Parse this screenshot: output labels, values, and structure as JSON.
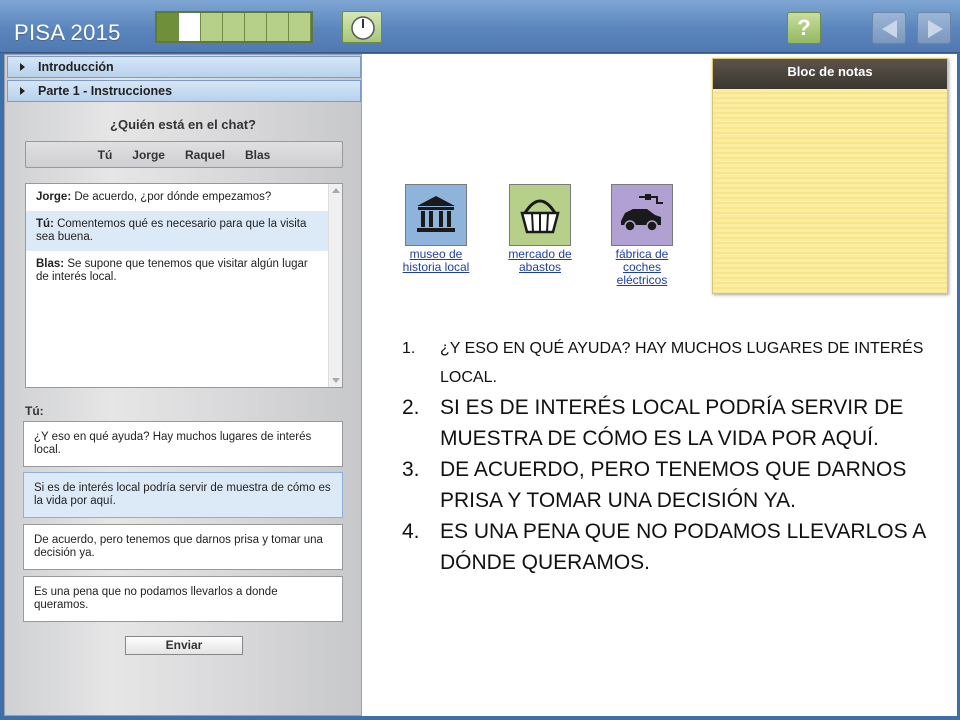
{
  "header": {
    "title": "PISA 2015",
    "progress": {
      "total_cells": 7,
      "completed": 1,
      "current": 2
    },
    "help_label": "?"
  },
  "left_pane": {
    "tabs": [
      {
        "label": "Introducción"
      },
      {
        "label": "Parte 1 - Instrucciones"
      }
    ],
    "chat_question": "¿Quién está en el chat?",
    "participants": [
      "Tú",
      "Jorge",
      "Raquel",
      "Blas"
    ],
    "messages": [
      {
        "speaker": "Jorge:",
        "text": "De acuerdo, ¿por dónde empezamos?"
      },
      {
        "speaker": "Tú:",
        "text": "Comentemos qué es necesario para que la visita sea buena."
      },
      {
        "speaker": "Blas:",
        "text": "Se supone que tenemos que visitar algún lugar de interés local."
      }
    ],
    "you_label": "Tú:",
    "options": [
      "¿Y eso en qué ayuda? Hay muchos lugares de interés local.",
      "Si es de interés local podría servir de muestra de cómo es la vida por aquí.",
      "De acuerdo, pero tenemos que darnos prisa y tomar una decisión ya.",
      "Es una pena que no podamos llevarlos a donde queramos."
    ],
    "send_label": "Enviar"
  },
  "right_pane": {
    "notepad_title": "Bloc de notas",
    "places": [
      {
        "label": "museo de historia local",
        "icon": "museum-icon"
      },
      {
        "label": "mercado de abastos",
        "icon": "basket-icon"
      },
      {
        "label": "fábrica de coches eléctricos",
        "icon": "electric-car-icon"
      }
    ],
    "responses": [
      {
        "num": "1.",
        "text": "¿Y ESO EN QUÉ AYUDA? HAY MUCHOS LUGARES DE INTERÉS LOCAL."
      },
      {
        "num": "2.",
        "text": "SI ES DE INTERÉS LOCAL PODRÍA SERVIR DE MUESTRA DE CÓMO ES LA VIDA POR AQUÍ."
      },
      {
        "num": "3.",
        "text": "DE ACUERDO, PERO TENEMOS QUE DARNOS PRISA Y TOMAR UNA DECISIÓN YA."
      },
      {
        "num": "4.",
        "text": "ES UNA PENA QUE NO PODAMOS LLEVARLOS A DÓNDE QUERAMOS."
      }
    ]
  }
}
